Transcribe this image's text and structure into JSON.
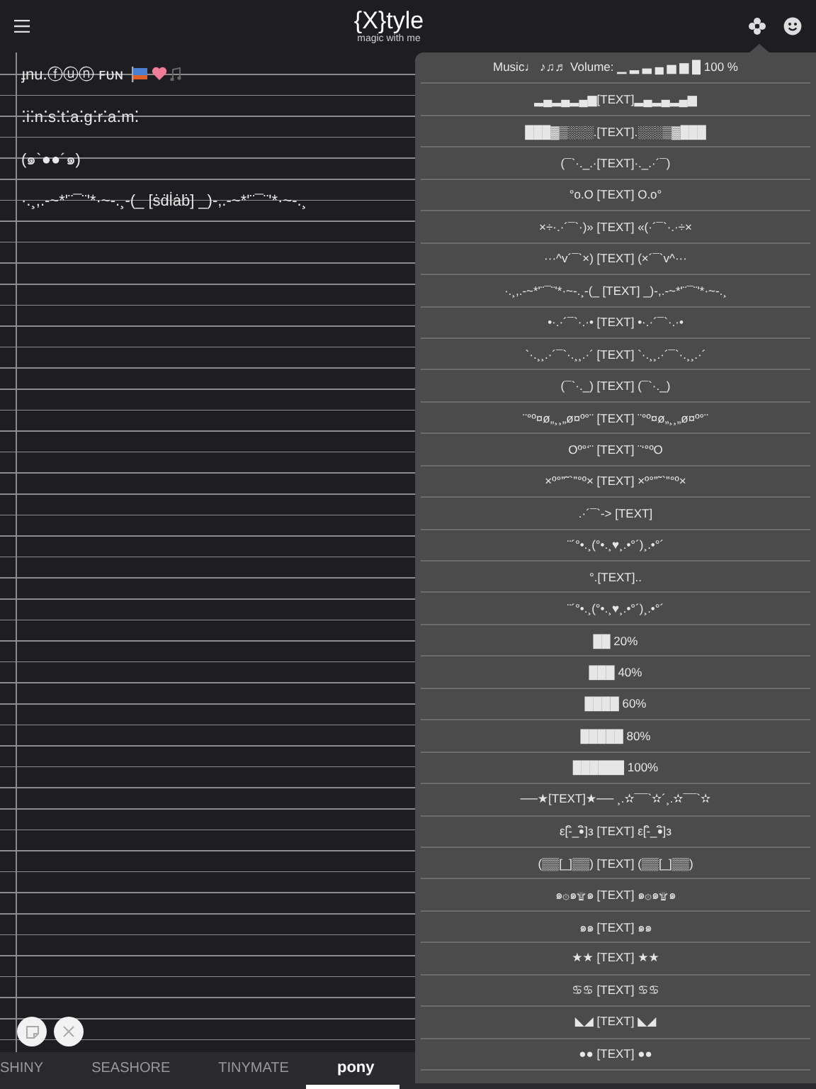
{
  "header": {
    "title": "{X}tyle",
    "subtitle": "magic with me"
  },
  "notes": [
    {
      "kind": "stickers",
      "text": "ɟnu.ⓕⓤⓝ ꜰᴜɴ"
    },
    {
      "kind": "text",
      "text": "⁚i⁚n⁚s⁚t⁚a⁚g⁚r⁚a⁚m⁚"
    },
    {
      "kind": "text",
      "text": "(๑`●●´๑)"
    },
    {
      "kind": "text",
      "text": "·.¸,.-~*'¨¯¨'*·~-.¸-(_ [ṡḋl̇ȧḃ] _)-,.-~*'¨¯¨'*·~-.¸"
    }
  ],
  "menu": {
    "items": [
      {
        "text": "Music♩ ♪♫♬ Volume: ▁ ▂ ▃ ▄ ▅ ▆ █ 100 %"
      },
      {
        "text": "▂▄▂▄▂▄▆[TEXT]▂▄▂▄▂▄▆"
      },
      {
        "text": "███▓▒░░░.[TEXT].░░░▒▓███"
      },
      {
        "text": "(¯`·._.·[TEXT]·._.·´¯)"
      },
      {
        "text": "°o.O [TEXT] O.o°"
      },
      {
        "text": "×÷·.·´¯`·)» [TEXT] «(·´¯`·.·÷×"
      },
      {
        "text": "···^v´¯`×) [TEXT] (×´¯`v^···"
      },
      {
        "text": "·.¸,.-~*'¨¯¨'*·~-.¸-(_ [TEXT] _)-,.-~*'¨¯¨'*·~-.¸"
      },
      {
        "text": "•·.·´¯`·.·• [TEXT] •·.·´¯`·.·•"
      },
      {
        "text": "`·.¸¸.·´¯`·.¸¸.·´ [TEXT] `·.¸¸.·´¯`·.¸¸.·´"
      },
      {
        "text": "(¯`·._) [TEXT] (¯`·._)"
      },
      {
        "text": "¨°º¤ø„¸¸„ø¤º°¨ [TEXT] ¨°º¤ø„¸¸„ø¤º°¨"
      },
      {
        "text": "Oº°‘¨ [TEXT] ¨‘°ºO"
      },
      {
        "text": "×º°”˜`”°º× [TEXT] ×º°”˜`”°º×"
      },
      {
        "text": ".·´¯`-> [TEXT]"
      },
      {
        "text": "¨´°•.¸(°•.¸♥¸.•°´)¸.•°´"
      },
      {
        "text": "°.[TEXT].."
      },
      {
        "text": "¨´°•.¸(°•.¸♥¸.•°´)¸.•°´"
      },
      {
        "text": "██ 20%"
      },
      {
        "text": "███ 40%"
      },
      {
        "text": "████ 60%"
      },
      {
        "text": "█████ 80%"
      },
      {
        "text": "██████ 100%"
      },
      {
        "text": "──★[TEXT]★── ¸.✫¯¯`✫´¸.✫¯¯`✫"
      },
      {
        "text": "ε[-ิ_•ิ]з [TEXT] ε[-ิ_•ิ]з"
      },
      {
        "text": "(▒▒[_]▒▒) [TEXT] (▒▒[_]▒▒)"
      },
      {
        "text": "๑۞๑۩๑ [TEXT] ๑۞๑۩๑"
      },
      {
        "text": "๑๑ [TEXT] ๑๑"
      },
      {
        "text": "★★ [TEXT] ★★"
      },
      {
        "text": "♋♋ [TEXT] ♋♋"
      },
      {
        "text": "◣◢ [TEXT] ◣◢"
      },
      {
        "text": "●● [TEXT] ●●"
      }
    ]
  },
  "tabs": [
    {
      "label": "SHINY",
      "selected": false
    },
    {
      "label": "SEASHORE",
      "selected": false
    },
    {
      "label": "TINYMATE",
      "selected": false
    },
    {
      "label": "pony",
      "selected": true
    }
  ]
}
